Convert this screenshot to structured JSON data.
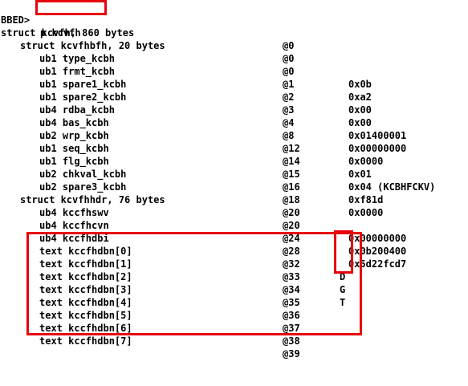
{
  "prompt": "BBED>",
  "command": "p kcvfh",
  "header_line": {
    "field": "struct kcvfh, 860 bytes",
    "offset": "@0"
  },
  "rows": [
    {
      "field": "struct kcvfhbfh, 20 bytes",
      "offset": "@0",
      "value": ""
    },
    {
      "field": "ub1 type_kcbh",
      "offset": "@0",
      "value": "0x0b"
    },
    {
      "field": "ub1 frmt_kcbh",
      "offset": "@1",
      "value": "0xa2"
    },
    {
      "field": "ub1 spare1_kcbh",
      "offset": "@2",
      "value": "0x00"
    },
    {
      "field": "ub1 spare2_kcbh",
      "offset": "@3",
      "value": "0x00"
    },
    {
      "field": "ub4 rdba_kcbh",
      "offset": "@4",
      "value": "0x01400001"
    },
    {
      "field": "ub4 bas_kcbh",
      "offset": "@8",
      "value": "0x00000000"
    },
    {
      "field": "ub2 wrp_kcbh",
      "offset": "@12",
      "value": "0x0000"
    },
    {
      "field": "ub1 seq_kcbh",
      "offset": "@14",
      "value": "0x01"
    },
    {
      "field": "ub1 flg_kcbh",
      "offset": "@15",
      "value": "0x04 (KCBHFCKV)"
    },
    {
      "field": "ub2 chkval_kcbh",
      "offset": "@16",
      "value": "0xf81d"
    },
    {
      "field": "ub2 spare3_kcbh",
      "offset": "@18",
      "value": "0x0000"
    },
    {
      "field": "struct kcvfhhdr, 76 bytes",
      "offset": "@20",
      "value": ""
    },
    {
      "field": "ub4 kccfhswv",
      "offset": "@20",
      "value": "0x00000000"
    },
    {
      "field": "ub4 kccfhcvn",
      "offset": "@24",
      "value": "0x0b200400"
    },
    {
      "field": "ub4 kccfhdbi",
      "offset": "@28",
      "value": "0x5d22fcd7"
    },
    {
      "field": "text kccfhdbn[0]",
      "offset": "@32",
      "value": "D"
    },
    {
      "field": "text kccfhdbn[1]",
      "offset": "@33",
      "value": "G"
    },
    {
      "field": "text kccfhdbn[2]",
      "offset": "@34",
      "value": "T"
    },
    {
      "field": "text kccfhdbn[3]",
      "offset": "@35",
      "value": ""
    },
    {
      "field": "text kccfhdbn[4]",
      "offset": "@36",
      "value": ""
    },
    {
      "field": "text kccfhdbn[5]",
      "offset": "@37",
      "value": ""
    },
    {
      "field": "text kccfhdbn[6]",
      "offset": "@38",
      "value": ""
    },
    {
      "field": "text kccfhdbn[7]",
      "offset": "@39",
      "value": ""
    }
  ],
  "annotation_color": "#e8000b"
}
